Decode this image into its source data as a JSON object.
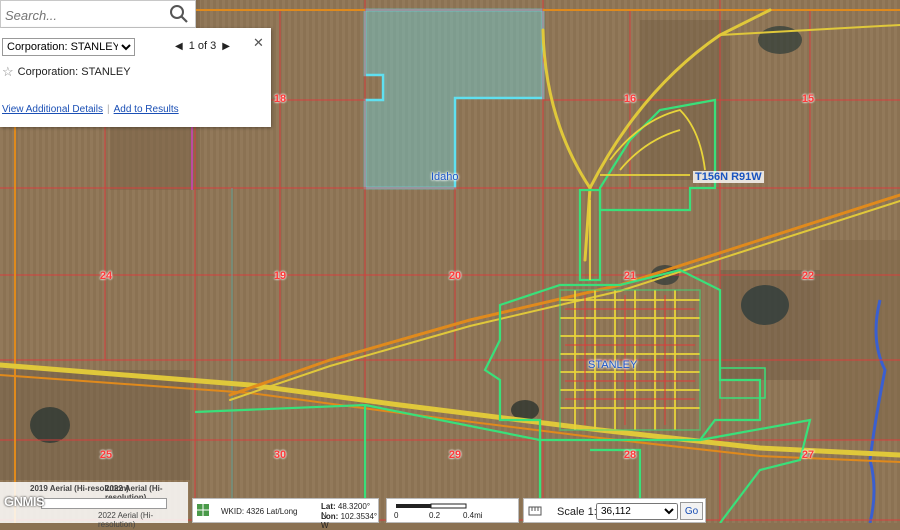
{
  "search": {
    "placeholder": "Search..."
  },
  "panel": {
    "selected_layer": "Corporation: STANLEY",
    "pager_text": "1 of 3",
    "result_label": "Corporation: STANLEY",
    "link_details": "View Additional Details",
    "link_results": "Add to Results"
  },
  "map": {
    "sections": [
      "18",
      "16",
      "15",
      "24",
      "19",
      "20",
      "21",
      "22",
      "25",
      "30",
      "29",
      "28",
      "27"
    ],
    "place_labels": [
      "Idaho",
      "STANLEY"
    ],
    "township_label": "T156N R91W",
    "colors": {
      "section_line": "#e03a3a",
      "road_yellow": "#e8d43a",
      "road_orange": "#e08a1c",
      "city_boundary": "#39e07a",
      "idaho_parcel": "#5fe0f0",
      "water": "#3a5fd0"
    }
  },
  "bottom": {
    "layer_2019": "2019 Aerial (Hi-resolution)",
    "layer_2022": "2022 Aerial (Hi-resolution)",
    "layer_2022_bottom": "2022 Aerial (Hi-resolution)",
    "gnm": "GNMIS",
    "wkid": "WKID: 4326 Lat/Long",
    "lat_label": "Lat:",
    "lat_value": "48.3200° N",
    "lon_label": "Lon:",
    "lon_value": "102.3534° W",
    "scale_ticks": [
      "0",
      "0.2",
      "0.4mi"
    ],
    "scale_label": "Scale 1:",
    "scale_value": "36,112",
    "go_label": "Go"
  }
}
